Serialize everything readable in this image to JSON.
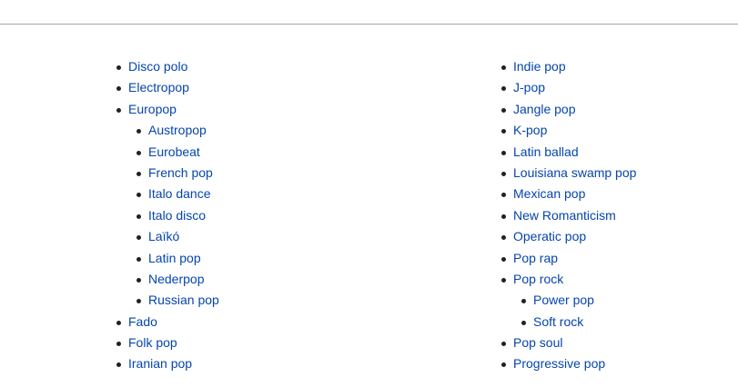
{
  "left_column": [
    {
      "label": "Disco polo",
      "level": 0
    },
    {
      "label": "Electropop",
      "level": 0
    },
    {
      "label": "Europop",
      "level": 0
    },
    {
      "label": "Austropop",
      "level": 1
    },
    {
      "label": "Eurobeat",
      "level": 1
    },
    {
      "label": "French pop",
      "level": 1
    },
    {
      "label": "Italo dance",
      "level": 1
    },
    {
      "label": "Italo disco",
      "level": 1
    },
    {
      "label": "Laïkó",
      "level": 1
    },
    {
      "label": "Latin pop",
      "level": 1
    },
    {
      "label": "Nederpop",
      "level": 1
    },
    {
      "label": "Russian pop",
      "level": 1
    },
    {
      "label": "Fado",
      "level": 0
    },
    {
      "label": "Folk pop",
      "level": 0
    },
    {
      "label": "Iranian pop",
      "level": 0
    }
  ],
  "right_column": [
    {
      "label": "Indie pop",
      "level": 0
    },
    {
      "label": "J-pop",
      "level": 0
    },
    {
      "label": "Jangle pop",
      "level": 0
    },
    {
      "label": "K-pop",
      "level": 0
    },
    {
      "label": "Latin ballad",
      "level": 0
    },
    {
      "label": "Louisiana swamp pop",
      "level": 0
    },
    {
      "label": "Mexican pop",
      "level": 0
    },
    {
      "label": "New Romanticism",
      "level": 0
    },
    {
      "label": "Operatic pop",
      "level": 0
    },
    {
      "label": "Pop rap",
      "level": 0
    },
    {
      "label": "Pop rock",
      "level": 0
    },
    {
      "label": "Power pop",
      "level": 1
    },
    {
      "label": "Soft rock",
      "level": 1
    },
    {
      "label": "Pop soul",
      "level": 0
    },
    {
      "label": "Progressive pop",
      "level": 0
    }
  ],
  "colors": {
    "link": "#0645ad",
    "bullet": "#202122",
    "divider": "#a2a9b1"
  }
}
